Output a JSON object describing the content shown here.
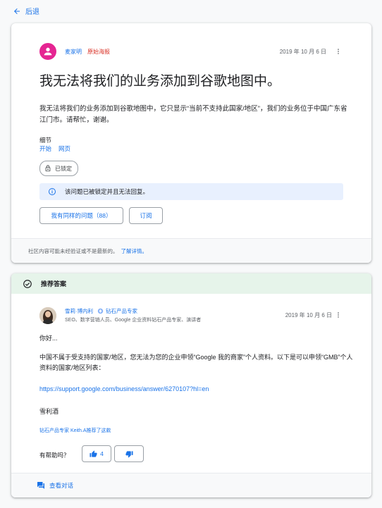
{
  "nav": {
    "back_label": "后退"
  },
  "question": {
    "author": "麦家明",
    "op_badge": "原始海报",
    "date": "2019 年 10 月 6 日",
    "title": "我无法将我们的业务添加到谷歌地图中。",
    "body": "我无法将我们的业务添加到谷歌地图中，它只显示“当前不支持此国家/地区”，我们的业务位于中国广东省江门市。请帮忙，谢谢。",
    "details_label": "细节",
    "details_links": [
      "开始",
      "网页"
    ],
    "locked_chip": "已锁定",
    "locked_notice": "该问题已被锁定并且无法回复。",
    "same_question_button": "我有同样的问题（88）",
    "subscribe_button": "订阅",
    "footer_text": "社区内容可能未经验证或不是最新的。",
    "footer_link": "了解详情。"
  },
  "answer": {
    "header": "推荐答案",
    "author": "雪莉·博内利",
    "expert_badge": "钻石产品专家",
    "author_subtitle": "SEO、数字营销人员、Google 企业资料钻石产品专家、演讲者",
    "date": "2019 年 10 月 6 日",
    "greeting": "你好...",
    "paragraph": "中国不属于受支持的国家/地区，您无法为您的企业申领“Google 我的商家”个人资料。以下是可以申领“GMB”个人资料的国家/地区列表：",
    "url": "https://support.google.com/business/answer/6270107?hl=en",
    "signature": "雪利酒",
    "recommended_by": "钻石产品专家 Keith.A推荐了这款",
    "helpful_label": "有帮助吗？",
    "upvote_count": "4",
    "view_conversation": "查看对话"
  },
  "icons": {
    "back": "arrow-left-icon",
    "avatar": "person-icon",
    "more": "more-vert-icon",
    "lock": "lock-icon",
    "info": "info-icon",
    "check": "check-circle-icon",
    "expert": "diamond-badge-icon",
    "thumb_up": "thumb-up-icon",
    "thumb_down": "thumb-down-icon",
    "conversation": "forum-icon"
  },
  "colors": {
    "accent": "#1a73e8",
    "avatar_pink": "#e52592",
    "op_red": "#d93025",
    "recommended_bg": "#e6f4ea",
    "notice_bg": "#e8f0fe"
  }
}
